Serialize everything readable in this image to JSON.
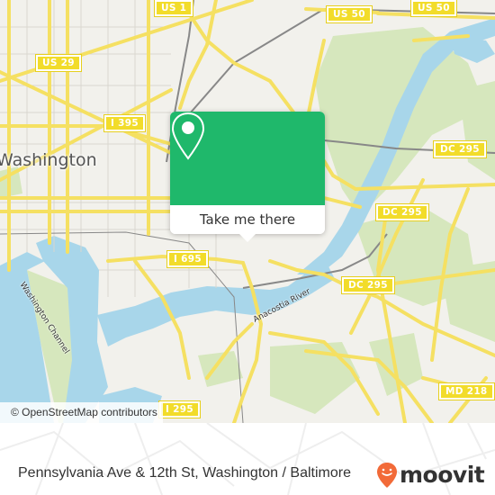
{
  "map": {
    "city_label": "Washington",
    "rivers": [
      {
        "name": "Washington Channel"
      },
      {
        "name": "Anacostia River"
      }
    ],
    "highway_shields": [
      {
        "label": "US 1"
      },
      {
        "label": "US 50"
      },
      {
        "label": "US 50"
      },
      {
        "label": "US 29"
      },
      {
        "label": "I 395"
      },
      {
        "label": "DC 295"
      },
      {
        "label": "DC 295"
      },
      {
        "label": "I 695"
      },
      {
        "label": "DC 295"
      },
      {
        "label": "I 295"
      },
      {
        "label": "MD 218"
      }
    ],
    "attribution": "© OpenStreetMap contributors",
    "colors": {
      "land": "#f2f1ec",
      "water": "#a8d6ea",
      "park": "#d6e7bd",
      "road": "#f5e062",
      "popup_green": "#1fb86b"
    }
  },
  "popup": {
    "icon": "location-pin-icon",
    "action_label": "Take me there"
  },
  "footer": {
    "title": "Pennsylvania Ave & 12th St, Washington / Baltimore",
    "brand": "moovit",
    "brand_color": "#f26a38"
  }
}
